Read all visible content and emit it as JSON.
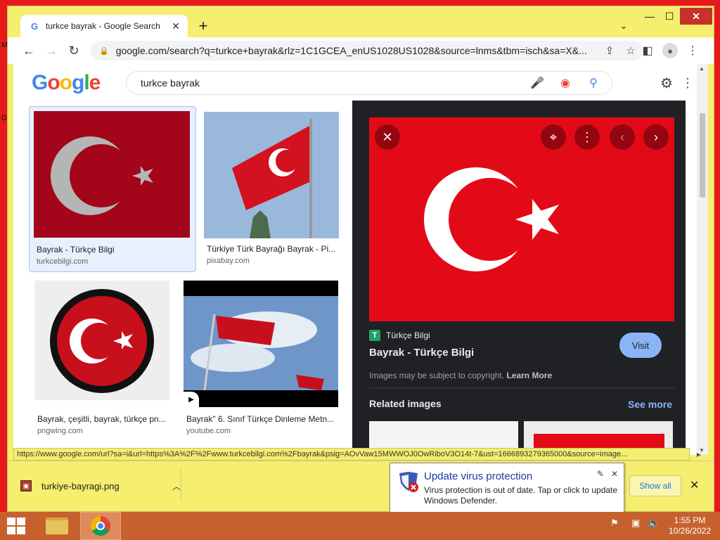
{
  "desktop": {
    "letters": [
      "M",
      "D"
    ]
  },
  "browser": {
    "tab_title": "turkce bayrak - Google Search",
    "tab_favicon": "G",
    "new_tab_glyph": "+",
    "url": "google.com/search?q=turkce+bayrak&rlz=1C1GCEA_enUS1028US1028&source=lnms&tbm=isch&sa=X&...",
    "window_controls": {
      "minimize": "—",
      "maximize": "☐",
      "close": "✕"
    }
  },
  "google": {
    "logo": [
      "G",
      "o",
      "o",
      "g",
      "l",
      "e"
    ],
    "query": "turkce bayrak"
  },
  "results": [
    {
      "title": "Bayrak - Türkçe Bilgi",
      "source": "turkcebilgi.com"
    },
    {
      "title": "Türkiye Türk Bayrağı Bayrak - Pi...",
      "source": "pixabay.com"
    },
    {
      "title": "Bayrak, çeşitli, bayrak, türkçe pn...",
      "source": "pngwing.com"
    },
    {
      "title": "Bayrak\" 6. Sınıf Türkçe Dinleme Metn...",
      "source": "youtube.com"
    }
  ],
  "preview": {
    "site_name": "Türkçe Bilgi",
    "site_favicon": "T",
    "title": "Bayrak - Türkçe Bilgi",
    "visit_label": "Visit",
    "copyright_text": "Images may be subject to copyright.",
    "learn_more": "Learn More",
    "related_label": "Related images",
    "see_more_label": "See more"
  },
  "status_url": "https://www.google.com/url?sa=i&url=https%3A%2F%2Fwww.turkcebilgi.com%2Fbayrak&psig=AOvVaw15MWWOJ0OwRiboV3O14t-7&ust=1666893279365000&source=image...",
  "downloads": {
    "file_name": "turkiye-bayragi.png",
    "show_all_label": "Show all"
  },
  "notification": {
    "title": "Update virus protection",
    "body": "Virus protection is out of date. Tap or click to update Windows Defender."
  },
  "taskbar": {
    "time": "1:55 PM",
    "date": "10/26/2022"
  },
  "colors": {
    "flag_red": "#e30a17",
    "taskbar": "#c6612d",
    "desktop_bg": "#e8191b",
    "window_frame": "#f5ee6e"
  }
}
